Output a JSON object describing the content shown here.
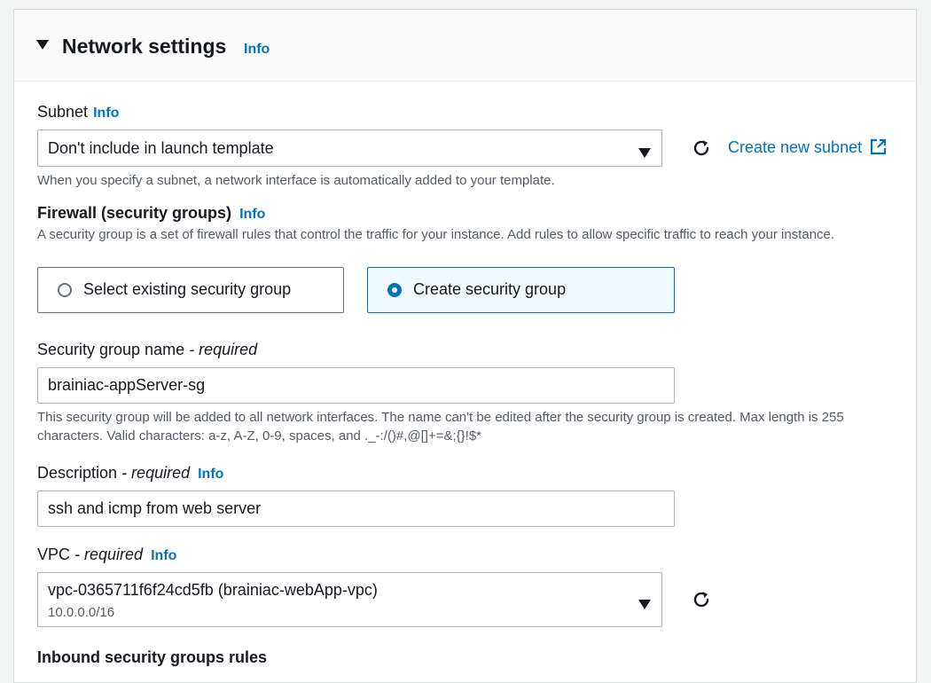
{
  "section": {
    "title": "Network settings",
    "info": "Info"
  },
  "subnet": {
    "label": "Subnet",
    "info": "Info",
    "value": "Don't include in launch template",
    "create_link": "Create new subnet",
    "hint": "When you specify a subnet, a network interface is automatically added to your template."
  },
  "firewall": {
    "label": "Firewall (security groups)",
    "info": "Info",
    "description": "A security group is a set of firewall rules that control the traffic for your instance. Add rules to allow specific traffic to reach your instance.",
    "options": [
      {
        "label": "Select existing security group",
        "selected": false
      },
      {
        "label": "Create security group",
        "selected": true
      }
    ]
  },
  "sg_name": {
    "label": "Security group name",
    "required": "- required",
    "value": "brainiac-appServer-sg",
    "hint": "This security group will be added to all network interfaces. The name can't be edited after the security group is created. Max length is 255 characters. Valid characters: a-z, A-Z, 0-9, spaces, and ._-:/()#,@[]+=&;{}!$*"
  },
  "description": {
    "label": "Description",
    "required": "- required",
    "info": "Info",
    "value": "ssh and icmp from web server"
  },
  "vpc": {
    "label": "VPC",
    "required": "- required",
    "info": "Info",
    "value": "vpc-0365711f6f24cd5fb (brainiac-webApp-vpc)",
    "sub": "10.0.0.0/16"
  },
  "inbound": {
    "label": "Inbound security groups rules"
  },
  "colors": {
    "link": "#0073bb",
    "text": "#16191f",
    "muted": "#545b64",
    "border": "#aab7b8",
    "selected_bg": "#f1faff"
  },
  "icons": [
    "caret-down-icon",
    "refresh-icon",
    "external-link-icon",
    "radio-icon"
  ]
}
